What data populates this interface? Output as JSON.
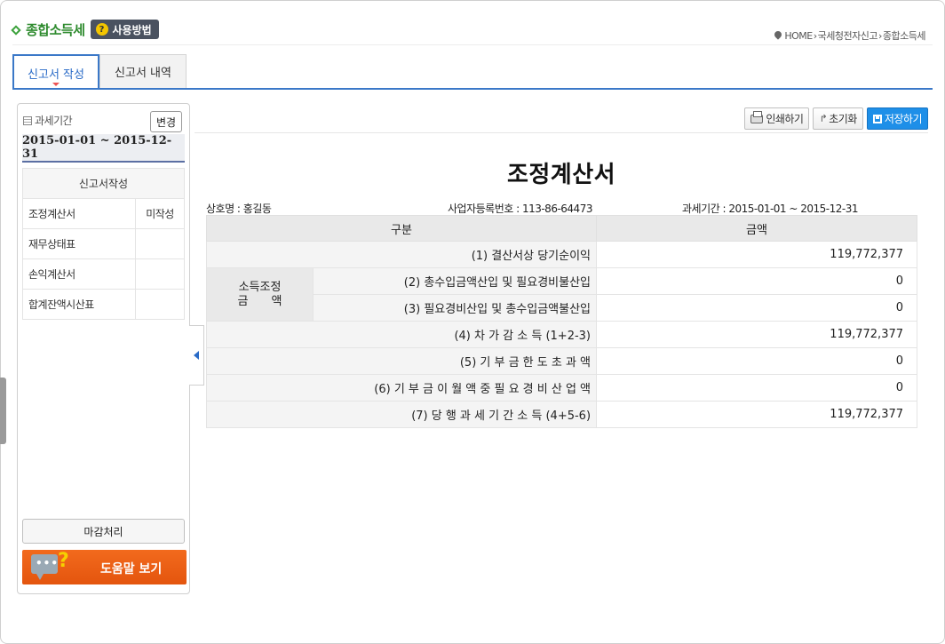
{
  "header": {
    "app_title": "종합소득세",
    "help_button": "사용방법",
    "help_icon": "?",
    "breadcrumb": [
      "HOME",
      "국세청전자신고",
      "종합소득세"
    ]
  },
  "tabs": [
    {
      "label": "신고서 작성",
      "active": true
    },
    {
      "label": "신고서 내역",
      "active": false
    }
  ],
  "sidebar": {
    "period_label": "과세기간",
    "change_button": "변경",
    "period_value": "2015-01-01 ~ 2015-12-31",
    "section_header": "신고서작성",
    "items": [
      {
        "label": "조정계산서",
        "status": "미작성"
      },
      {
        "label": "재무상태표",
        "status": ""
      },
      {
        "label": "손익계산서",
        "status": ""
      },
      {
        "label": "합계잔액시산표",
        "status": ""
      }
    ],
    "close_button": "마감처리",
    "help_view_button": "도움말 보기",
    "help_view_dots": "•••",
    "help_view_qmark": "?"
  },
  "toolbar": {
    "print": "인쇄하기",
    "reset": "초기화",
    "save": "저장하기"
  },
  "document": {
    "title": "조정계산서",
    "company_label": "상호명 : 홍길동",
    "regno_label": "사업자등록번호 : 113-86-64473",
    "period_label": "과세기간 : 2015-01-01 ~ 2015-12-31",
    "col_category": "구분",
    "col_amount": "금액",
    "group_label_line1": "소득조정",
    "group_label_line2": "금　　액",
    "rows": [
      {
        "label": "(1) 결산서상 당기순이익",
        "amount": "119,772,377"
      },
      {
        "label": "(2) 총수입금액산입 및 필요경비불산입",
        "amount": "0"
      },
      {
        "label": "(3) 필요경비산입 및 총수입금액불산입",
        "amount": "0"
      },
      {
        "label": "(4) 차 가 감 소 득 (1+2-3)",
        "amount": "119,772,377"
      },
      {
        "label": "(5) 기 부 금 한 도 초 과 액",
        "amount": "0"
      },
      {
        "label": "(6) 기 부 금 이 월 액 중 필 요 경 비 산 업 액",
        "amount": "0"
      },
      {
        "label": "(7) 당 행 과 세 기 간 소 득 (4+5-6)",
        "amount": "119,772,377"
      }
    ]
  },
  "colors": {
    "accent": "#3b78c8",
    "title_green": "#2e8b2e",
    "save_blue": "#1e8fe8",
    "help_orange": "#f26a1d"
  }
}
